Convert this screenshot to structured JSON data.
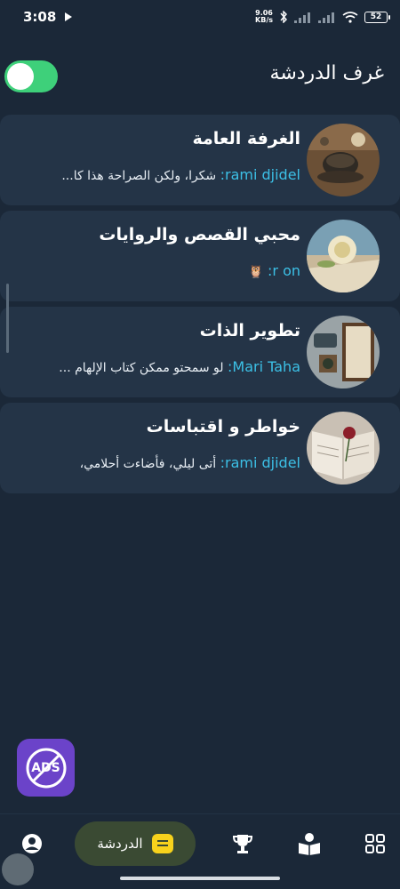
{
  "status_bar": {
    "time": "3:08",
    "net_speed_value": "9.06",
    "net_speed_unit": "KB/s",
    "battery": "52"
  },
  "header": {
    "title": "غرف الدردشة"
  },
  "rooms": [
    {
      "name": "الغرفة العامة",
      "sender": "rami djidel:",
      "message": "شكرا، ولكن الصراحة هذا كا...",
      "avatar": "tea-cup-photo"
    },
    {
      "name": "محبي القصص والروايات",
      "sender": "r on:",
      "message": "🦉",
      "avatar": "rose-book-photo"
    },
    {
      "name": "تطوير الذات",
      "sender": "Mari Taha:",
      "message": "لو سمحتو ممكن كتاب الإلهام ...",
      "avatar": "books-photo"
    },
    {
      "name": "خواطر و اقتباسات",
      "sender": "rami djidel:",
      "message": "أتى ليلي، فأضاءت أحلامي،",
      "avatar": "open-book-rose-photo"
    }
  ],
  "ads_button": {
    "label": "ADS"
  },
  "bottom_nav": {
    "chat_label": "الدردشة",
    "items": [
      "profile-icon",
      "chat-icon",
      "trophy-icon",
      "reader-icon",
      "grid-icon"
    ]
  }
}
